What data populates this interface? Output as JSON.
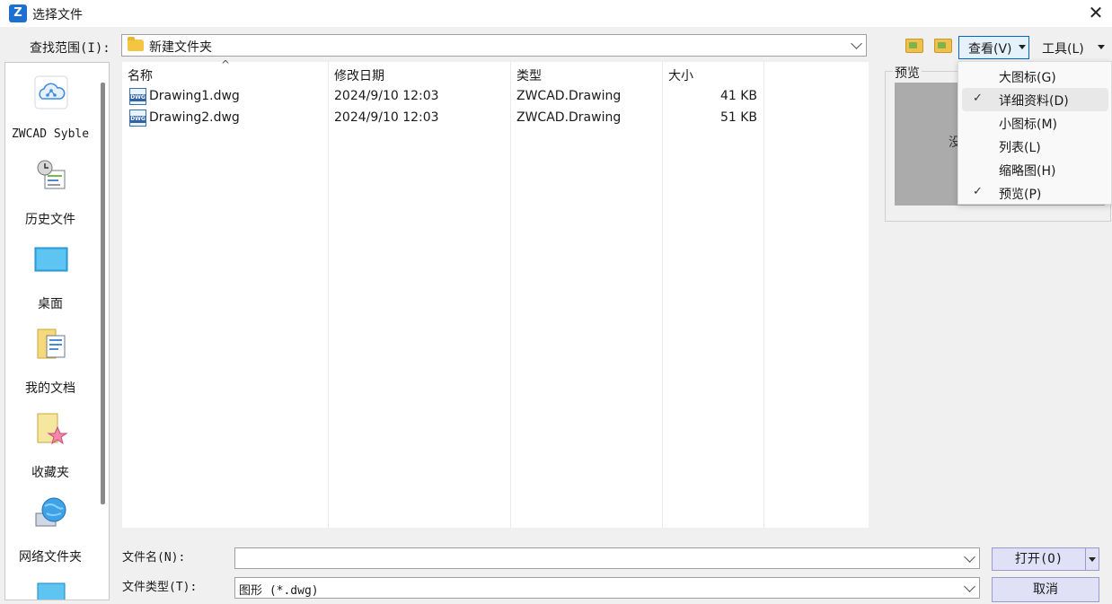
{
  "window": {
    "title": "选择文件",
    "close_glyph": "✕"
  },
  "app_icon": {
    "name": "zwcad-logo-icon",
    "glyph": "Z",
    "color": "#1f6fd1"
  },
  "lookin": {
    "label": "查找范围(I):",
    "value": "新建文件夹"
  },
  "toolbar": {
    "view_label": "查看(V)",
    "tools_label": "工具(L)"
  },
  "places": [
    {
      "label": "ZWCAD Syble",
      "icon": "cloud-icon"
    },
    {
      "label": "历史文件",
      "icon": "history-icon"
    },
    {
      "label": "桌面",
      "icon": "desktop-icon"
    },
    {
      "label": "我的文档",
      "icon": "documents-icon"
    },
    {
      "label": "收藏夹",
      "icon": "favorites-icon"
    },
    {
      "label": "网络文件夹",
      "icon": "network-folder-icon"
    }
  ],
  "filelist": {
    "columns": [
      "名称",
      "修改日期",
      "类型",
      "大小"
    ],
    "sort_indicator": "^",
    "rows": [
      {
        "name": "Drawing1.dwg",
        "modified": "2024/9/10 12:03",
        "type": "ZWCAD.Drawing",
        "size": "41 KB"
      },
      {
        "name": "Drawing2.dwg",
        "modified": "2024/9/10 12:03",
        "type": "ZWCAD.Drawing",
        "size": "51 KB"
      }
    ],
    "file_icon_text": "DWG"
  },
  "preview": {
    "label": "预览",
    "message": "没"
  },
  "view_menu": {
    "items": [
      {
        "label": "大图标(G)",
        "checked": false
      },
      {
        "label": "详细资料(D)",
        "checked": true,
        "highlighted": true
      },
      {
        "label": "小图标(M)",
        "checked": false
      },
      {
        "label": "列表(L)",
        "checked": false
      },
      {
        "label": "缩略图(H)",
        "checked": false
      },
      {
        "label": "预览(P)",
        "checked": true
      }
    ],
    "check_glyph": "✓"
  },
  "bottom": {
    "filename_label": "文件名(N):",
    "filename_value": "",
    "filetype_label": "文件类型(T):",
    "filetype_value": "图形 (*.dwg)",
    "open_label": "打开(O)",
    "cancel_label": "取消"
  }
}
